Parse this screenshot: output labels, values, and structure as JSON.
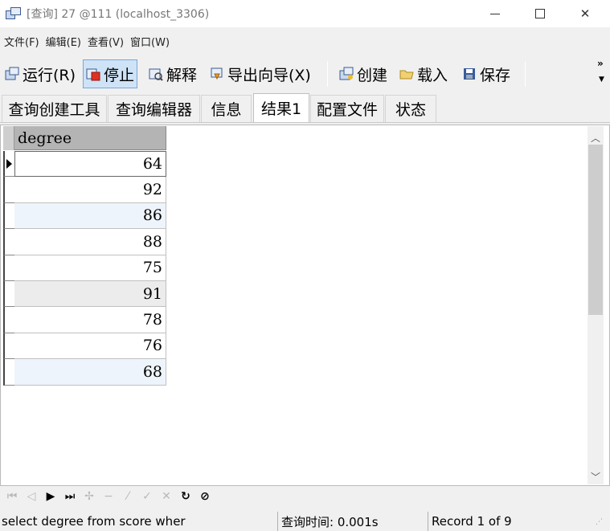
{
  "window": {
    "title": "[查询] 27 @111 (localhost_3306)"
  },
  "menu": [
    "文件(F)",
    "编辑(E)",
    "查看(V)",
    "窗口(W)"
  ],
  "toolbar": {
    "run": "运行(R)",
    "stop": "停止",
    "explain": "解释",
    "export": "导出向导(X)",
    "create": "创建",
    "load": "载入",
    "save": "保存",
    "overflow": "»"
  },
  "tabs": [
    "查询创建工具",
    "查询编辑器",
    "信息",
    "结果1",
    "配置文件",
    "状态"
  ],
  "active_tab": "结果1",
  "grid": {
    "column": "degree",
    "rows": [
      "64",
      "92",
      "86",
      "88",
      "75",
      "91",
      "78",
      "76",
      "68"
    ]
  },
  "status": {
    "query": "select degree from score wher",
    "time": "查询时间: 0.001s",
    "record": "Record 1 of 9"
  }
}
